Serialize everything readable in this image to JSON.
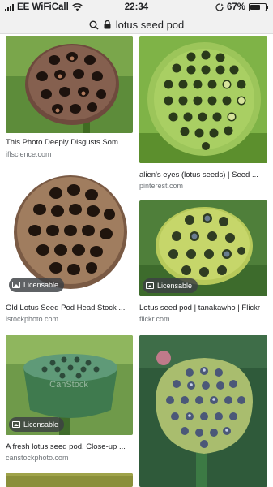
{
  "status": {
    "carrier": "EE WiFiCall",
    "time": "22:34",
    "battery": "67%",
    "battery_fraction": 0.67
  },
  "url_bar": {
    "query": "lotus seed pod"
  },
  "results": [
    {
      "caption": "This Photo Deeply Disgusts Som...",
      "domain": "iflscience.com",
      "badge": ""
    },
    {
      "caption": "alien's eyes (lotus seeds) | Seed ...",
      "domain": "pinterest.com",
      "badge": ""
    },
    {
      "caption": "Old Lotus Seed Pod Head Stock ...",
      "domain": "istockphoto.com",
      "badge": "Licensable"
    },
    {
      "caption": "Lotus seed pod | tanakawho | Flickr",
      "domain": "flickr.com",
      "badge": "Licensable"
    },
    {
      "caption": "A fresh lotus seed pod. Close-up ...",
      "domain": "canstockphoto.com",
      "badge": "Licensable"
    },
    {
      "caption": "",
      "domain": "",
      "badge": ""
    }
  ],
  "colors": {
    "chrome_bg": "#f1f1f1",
    "caption_text": "#202124",
    "domain_text": "#70757a",
    "badge_bg": "#3c4043"
  }
}
